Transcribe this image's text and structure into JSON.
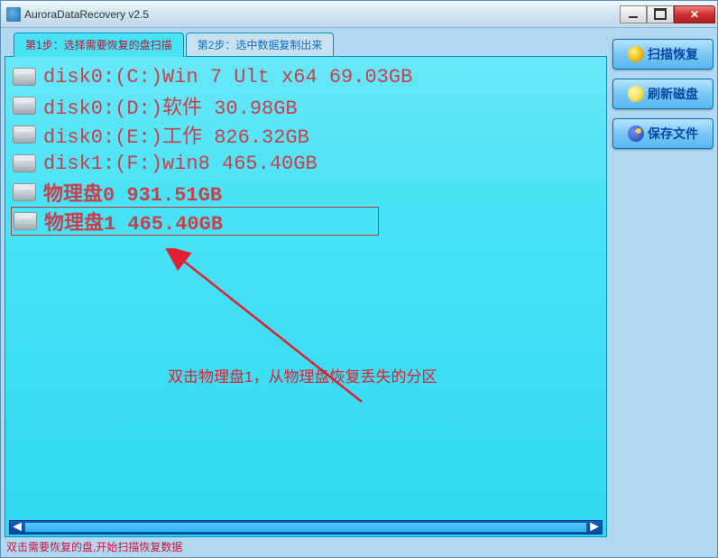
{
  "window": {
    "title": "AuroraDataRecovery v2.5"
  },
  "tabs": {
    "step1": "第1步：选择需要恢复的盘扫描",
    "step2": "第2步：选中数据复制出来"
  },
  "disks": [
    {
      "label": "disk0:(C:)Win 7 Ult x64 69.03GB",
      "physical": false,
      "selected": false
    },
    {
      "label": "disk0:(D:)软件 30.98GB",
      "physical": false,
      "selected": false
    },
    {
      "label": "disk0:(E:)工作 826.32GB",
      "physical": false,
      "selected": false
    },
    {
      "label": "disk1:(F:)win8 465.40GB",
      "physical": false,
      "selected": false
    },
    {
      "label": "物理盘0 931.51GB",
      "physical": true,
      "selected": false
    },
    {
      "label": "物理盘1 465.40GB",
      "physical": true,
      "selected": true
    }
  ],
  "annotation": "双击物理盘1，从物理盘恢复丢失的分区",
  "buttons": {
    "scan": "扫描恢复",
    "refresh": "刷新磁盘",
    "save": "保存文件"
  },
  "status": "双击需要恢复的盘,开始扫描恢复数据"
}
